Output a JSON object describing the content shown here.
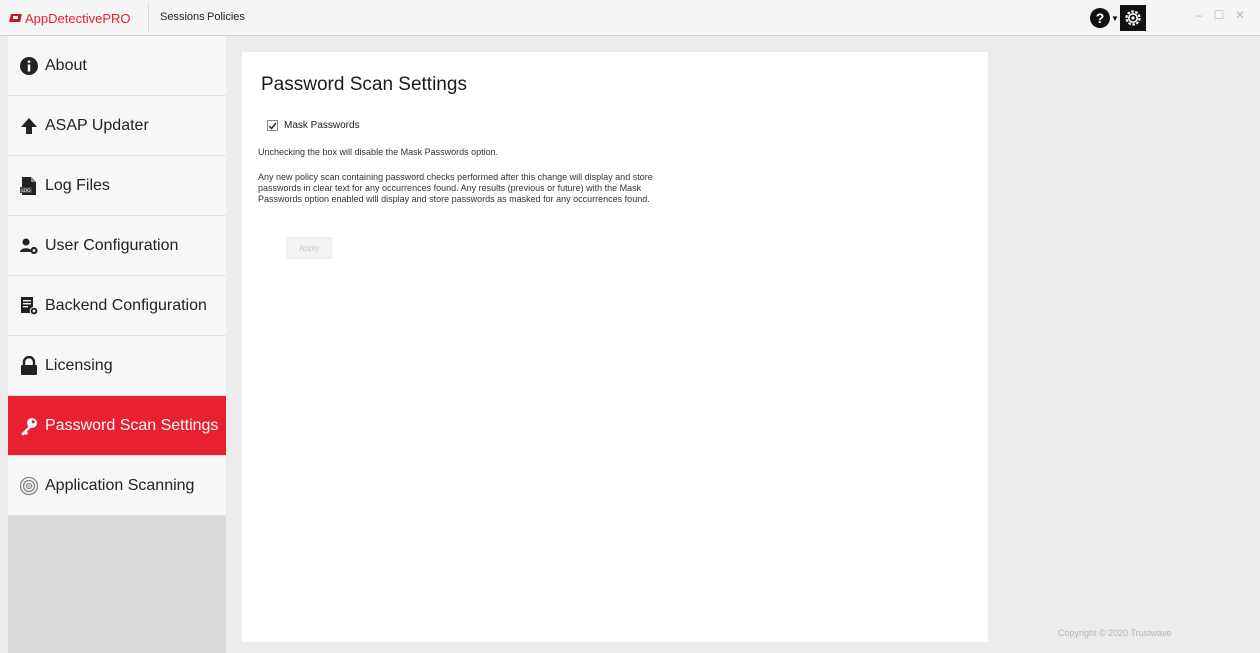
{
  "app": {
    "name": "AppDetectivePRO",
    "nav": {
      "sessions": "Sessions",
      "policies": "Policies"
    },
    "window_controls": {
      "minimize": "–",
      "maximize": "☐",
      "close": "✕"
    }
  },
  "sidebar": {
    "items": [
      {
        "label": "About",
        "icon": "info-icon"
      },
      {
        "label": "ASAP Updater",
        "icon": "arrow-up-icon"
      },
      {
        "label": "Log Files",
        "icon": "log-file-icon"
      },
      {
        "label": "User Configuration",
        "icon": "user-gear-icon"
      },
      {
        "label": "Backend Configuration",
        "icon": "document-gear-icon"
      },
      {
        "label": "Licensing",
        "icon": "lock-icon"
      },
      {
        "label": "Password Scan Settings",
        "icon": "key-icon",
        "active": true
      },
      {
        "label": "Application Scanning",
        "icon": "radar-icon"
      }
    ]
  },
  "main": {
    "title": "Password Scan Settings",
    "mask_passwords": {
      "label": "Mask Passwords",
      "checked": true
    },
    "description1": "Unchecking the box will disable the Mask Passwords option.",
    "description2": "Any new policy scan containing password checks performed after this change will display and store passwords in clear text for any occurrences found. Any results (previous or future) with the Mask Passwords option enabled will display and store passwords as masked for any occurrences found.",
    "apply_label": "Apply"
  },
  "footer": {
    "copyright": "Copyright © 2020 Trustwave"
  },
  "colors": {
    "accent": "#e8202f",
    "sidebar_bg": "#f7f7f7",
    "page_bg": "#ececec"
  }
}
